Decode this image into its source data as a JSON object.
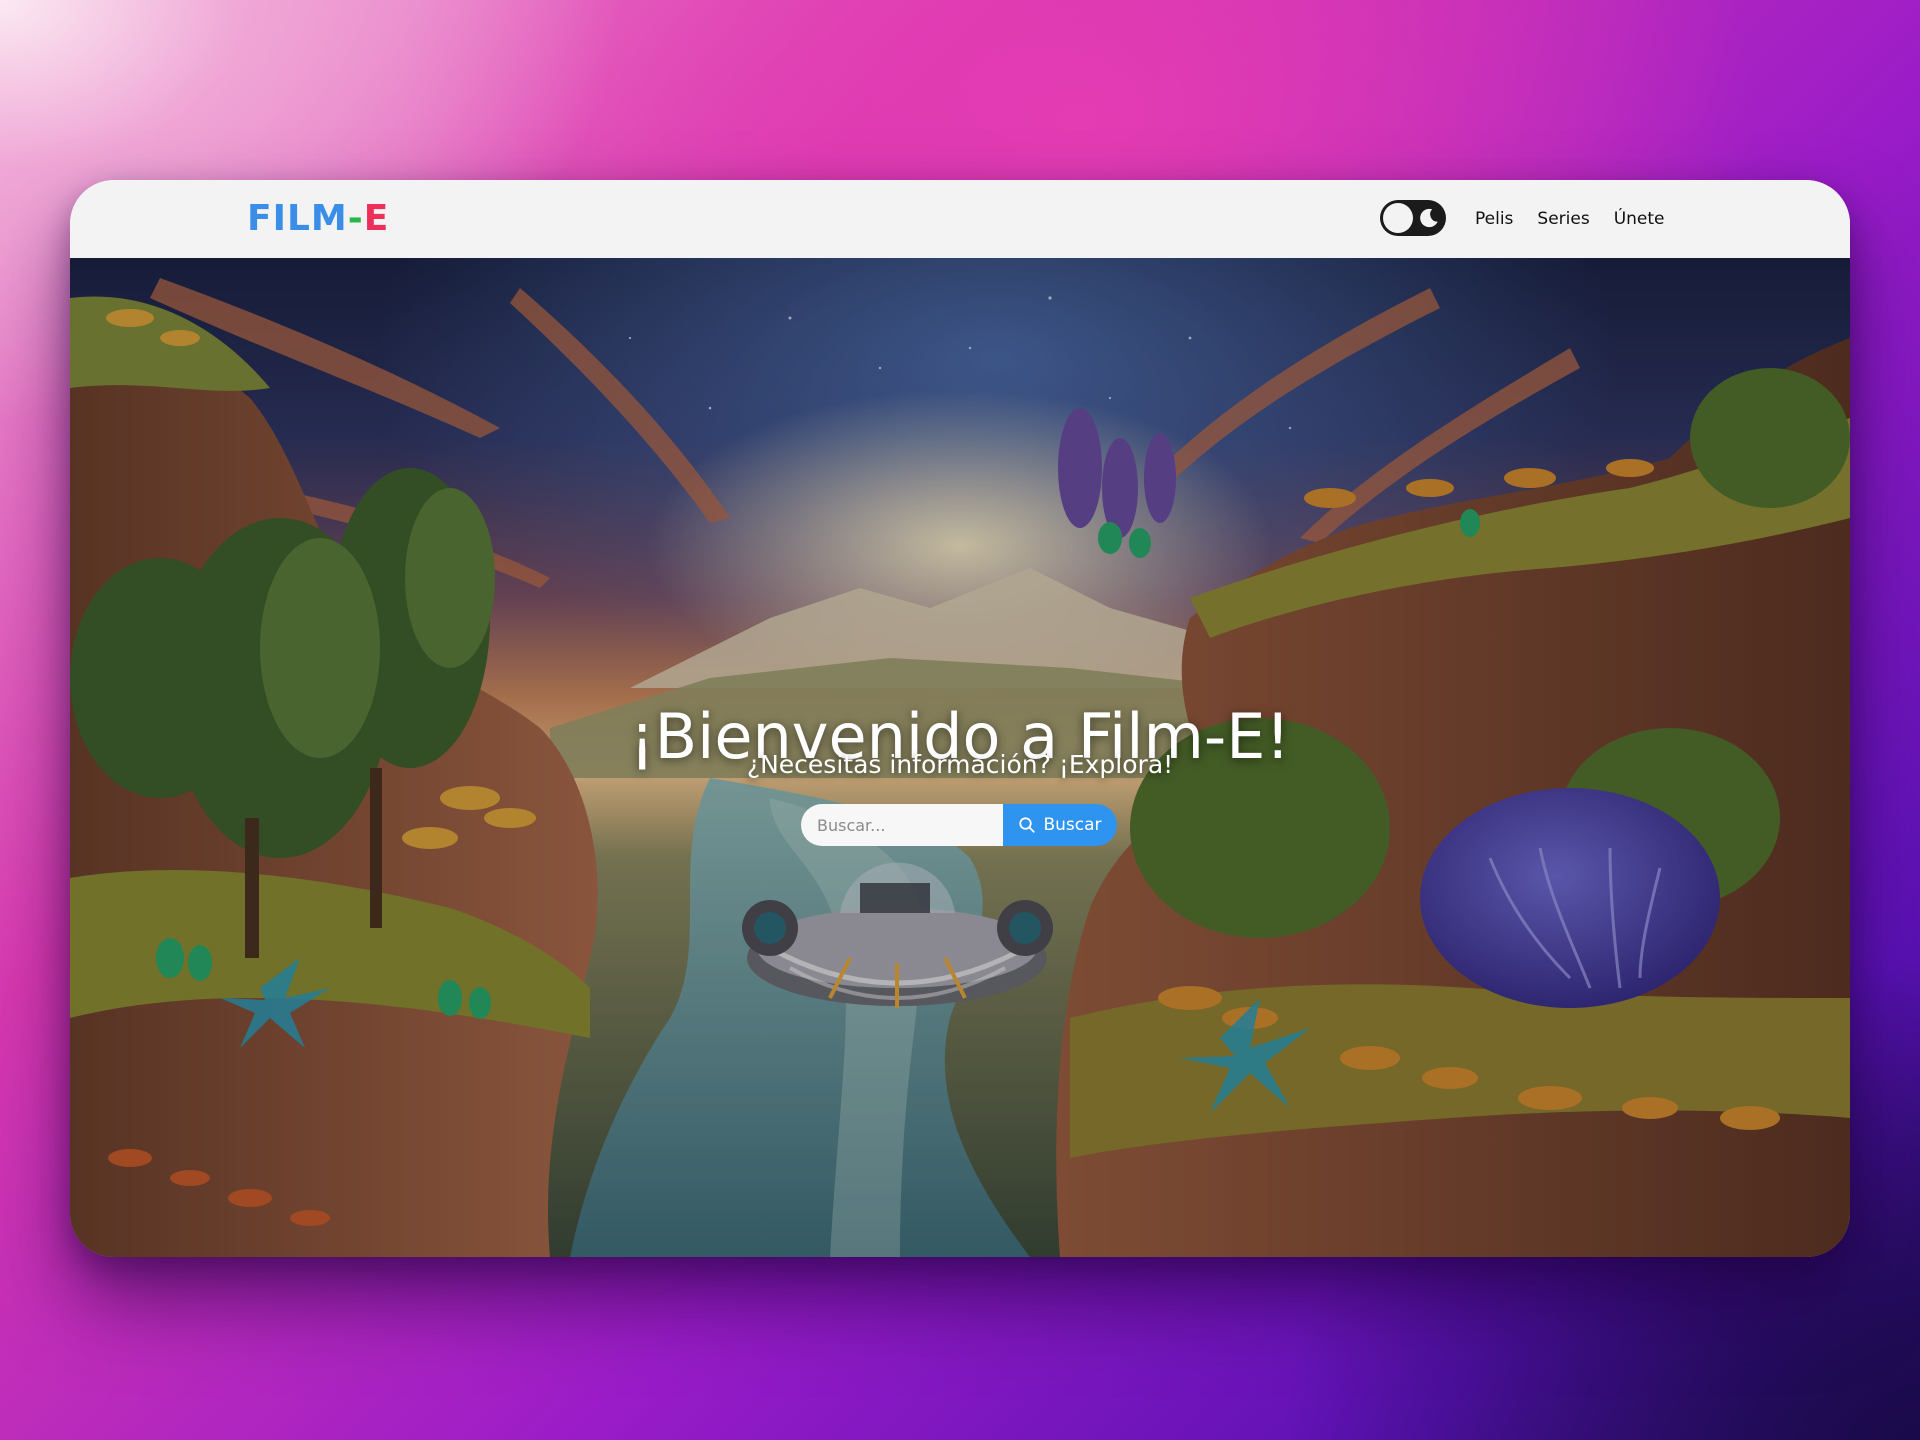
{
  "navbar": {
    "brand": {
      "part1": "FILM",
      "part2": "-",
      "part3": "E"
    },
    "links": [
      "Pelis",
      "Series",
      "Únete"
    ]
  },
  "theme_toggle": {
    "icon": "moon-icon",
    "state": "dark-mode-off"
  },
  "hero": {
    "title": "¡Bienvenido a Film-E!",
    "subtitle": "¿Necesitas información? ¡Explora!",
    "search": {
      "placeholder": "Buscar...",
      "value": "",
      "button_label": "Buscar",
      "button_icon": "search-icon"
    }
  },
  "colors": {
    "brand_blue": "#3a8ee8",
    "brand_green": "#28b84a",
    "brand_red": "#ee2f5a",
    "accent": "#2f93f0",
    "navbar_bg": "#f3f3f3"
  }
}
